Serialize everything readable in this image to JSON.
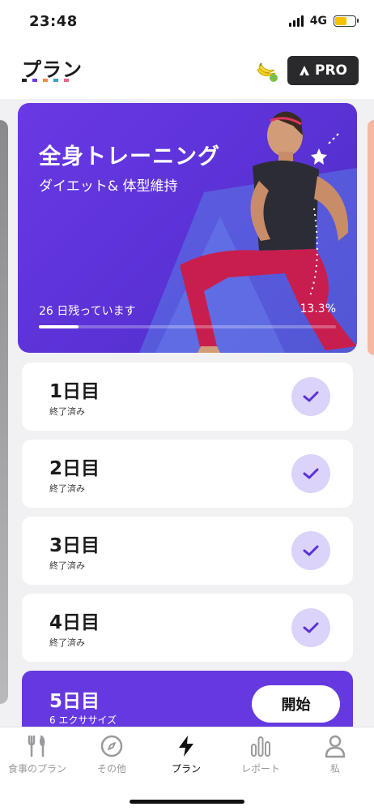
{
  "status_bar": {
    "time": "23:48",
    "network": "4G",
    "battery_color": "#f5c400"
  },
  "header": {
    "title": "プラン",
    "dot_colors": [
      "#222222",
      "#6a38e4",
      "#f08a4b",
      "#3aa0c8",
      "#e46a8a"
    ],
    "banana_icon": "banana-icon",
    "pro_label": "PRO"
  },
  "hero": {
    "title": "全身トレーニング",
    "subtitle": "ダイエット& 体型維持",
    "remaining": "26 日残っています",
    "percent": "13.3%",
    "progress": 0.133,
    "accent": "#6a38e4"
  },
  "days": [
    {
      "title": "1日目",
      "status": "終了済み",
      "completed": true
    },
    {
      "title": "2日目",
      "status": "終了済み",
      "completed": true
    },
    {
      "title": "3日目",
      "status": "終了済み",
      "completed": true
    },
    {
      "title": "4日目",
      "status": "終了済み",
      "completed": true
    }
  ],
  "next_day": {
    "title": "5日目",
    "subtitle": "6 エクササイズ",
    "start_label": "開始"
  },
  "bottom_nav": [
    {
      "label": "食事のプラン",
      "icon": "fork-knife-icon",
      "active": false
    },
    {
      "label": "その他",
      "icon": "compass-icon",
      "active": false
    },
    {
      "label": "プラン",
      "icon": "lightning-icon",
      "active": true
    },
    {
      "label": "レポート",
      "icon": "bar-chart-icon",
      "active": false
    },
    {
      "label": "私",
      "icon": "person-icon",
      "active": false
    }
  ]
}
